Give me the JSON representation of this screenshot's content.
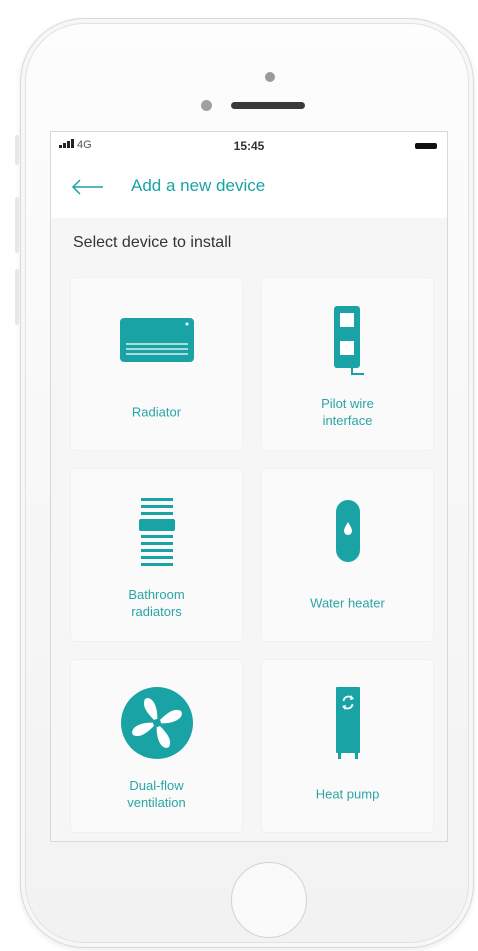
{
  "status_bar": {
    "network": "4G",
    "time": "15:45"
  },
  "header": {
    "title": "Add a new device",
    "back_icon": "arrow-left-icon"
  },
  "subtitle": "Select device to install",
  "colors": {
    "accent": "#1aa3a5",
    "tile_bg": "#fafafa",
    "screen_bg": "#f6f6f6"
  },
  "devices": [
    {
      "label": "Radiator",
      "icon": "radiator-icon"
    },
    {
      "label": "Pilot wire\ninterface",
      "icon": "pilot-wire-icon"
    },
    {
      "label": "Bathroom\nradiators",
      "icon": "towel-radiator-icon"
    },
    {
      "label": "Water heater",
      "icon": "water-heater-icon"
    },
    {
      "label": "Dual-flow\nventilation",
      "icon": "fan-icon"
    },
    {
      "label": "Heat pump",
      "icon": "heat-pump-icon"
    }
  ]
}
